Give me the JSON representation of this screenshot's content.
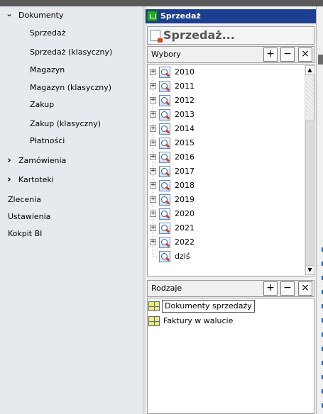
{
  "nav": {
    "items": [
      {
        "label": "Dokumenty",
        "expanded": true,
        "level": 0
      },
      {
        "label": "Sprzedaż",
        "level": 1
      },
      {
        "label": "Sprzedaż (klasyczny)",
        "level": 1
      },
      {
        "label": "Magazyn",
        "level": 1
      },
      {
        "label": "Magazyn (klasyczny)",
        "level": 1
      },
      {
        "label": "Zakup",
        "level": 1
      },
      {
        "label": "Zakup (klasyczny)",
        "level": 1
      },
      {
        "label": "Płatności",
        "level": 1
      },
      {
        "label": "Zamówienia",
        "expanded": false,
        "level": 0
      },
      {
        "label": "Kartoteki",
        "expanded": false,
        "level": 0
      },
      {
        "label": "Zlecenia",
        "level": 0
      },
      {
        "label": "Ustawienia",
        "level": 0
      },
      {
        "label": "Kokpit BI",
        "level": 0
      }
    ],
    "icons": {
      "expanded": "chevron-down-icon",
      "collapsed": "chevron-right-icon"
    }
  },
  "window": {
    "title": "Sprzedaż",
    "header_title": "Sprzedaż...",
    "accent_color": "#1c3f8f"
  },
  "wybory": {
    "label": "Wybory",
    "add_label": "+",
    "remove_label": "−",
    "close_label": "×",
    "tree": [
      {
        "label": "2010",
        "expandable": true
      },
      {
        "label": "2011",
        "expandable": true
      },
      {
        "label": "2012",
        "expandable": true
      },
      {
        "label": "2013",
        "expandable": true
      },
      {
        "label": "2014",
        "expandable": true
      },
      {
        "label": "2015",
        "expandable": true
      },
      {
        "label": "2016",
        "expandable": true
      },
      {
        "label": "2017",
        "expandable": true
      },
      {
        "label": "2018",
        "expandable": true
      },
      {
        "label": "2019",
        "expandable": true
      },
      {
        "label": "2020",
        "expandable": true
      },
      {
        "label": "2021",
        "expandable": true
      },
      {
        "label": "2022",
        "expandable": true
      },
      {
        "label": "dziś",
        "expandable": false
      }
    ],
    "expand_glyph": "+"
  },
  "rodzaje": {
    "label": "Rodzaje",
    "add_label": "+",
    "remove_label": "−",
    "close_label": "×",
    "items": [
      {
        "label": "Dokumenty sprzedaży",
        "highlighted": true
      },
      {
        "label": "Faktury w walucie",
        "highlighted": false
      }
    ]
  },
  "scrollbar": {
    "up": "▲",
    "down": "▼"
  }
}
